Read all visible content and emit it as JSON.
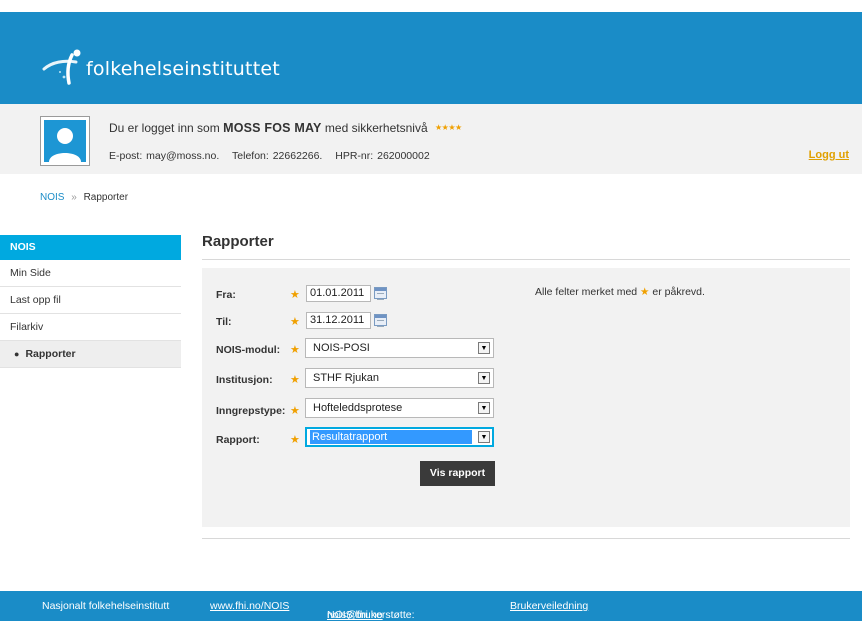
{
  "header": {
    "logo_text": "folkehelseinstituttet",
    "bg_color": "#1a8cc7"
  },
  "user": {
    "greeting_prefix": "Du er logget inn som",
    "name": "MOSS FOS MAY",
    "greeting_suffix": "med sikkerhetsnivå",
    "security_level_stars": 4,
    "email": "E-post: may@moss.no.",
    "phone": "Telefon: 22662266.",
    "hpr": "HPR-nr: 262000002",
    "logout_label": "Logg ut"
  },
  "breadcrumb": {
    "root": "NOIS",
    "separator": "»",
    "current": "Rapporter"
  },
  "sidebar": {
    "header": "NOIS",
    "items": [
      {
        "label": "Min Side",
        "active": false
      },
      {
        "label": "Last opp fil",
        "active": false
      },
      {
        "label": "Filarkiv",
        "active": false
      },
      {
        "label": "Rapporter",
        "active": true
      }
    ]
  },
  "main": {
    "title": "Rapporter",
    "required_note_prefix": "Alle felter merket med",
    "required_note_suffix": "er påkrevd.",
    "form": {
      "fra_label": "Fra:",
      "fra_value": "01.01.2011",
      "til_label": "Til:",
      "til_value": "31.12.2011",
      "modul_label": "NOIS-modul:",
      "modul_value": "NOIS-POSI",
      "institusjon_label": "Institusjon:",
      "institusjon_value": "STHF Rjukan",
      "inngrep_label": "Inngrepstype:",
      "inngrep_value": "Hofteleddsprotese",
      "rapport_label": "Rapport:",
      "rapport_value": "Resultatrapport",
      "submit_label": "Vis rapport"
    }
  },
  "footer": {
    "org": "Nasjonalt folkehelseinstitutt",
    "link": "www.fhi.no/NOIS",
    "support_prefix": "NOIS brukerstøtte:",
    "support_email": "nois@fhi.no",
    "guide": "Brukerveiledning"
  },
  "colors": {
    "accent": "#00a9e0",
    "brand": "#1a8cc7",
    "star": "#f0a000"
  },
  "icons": [
    "logo-mark-icon",
    "avatar-icon",
    "calendar-icon",
    "chevron-down-icon",
    "star-icon"
  ]
}
